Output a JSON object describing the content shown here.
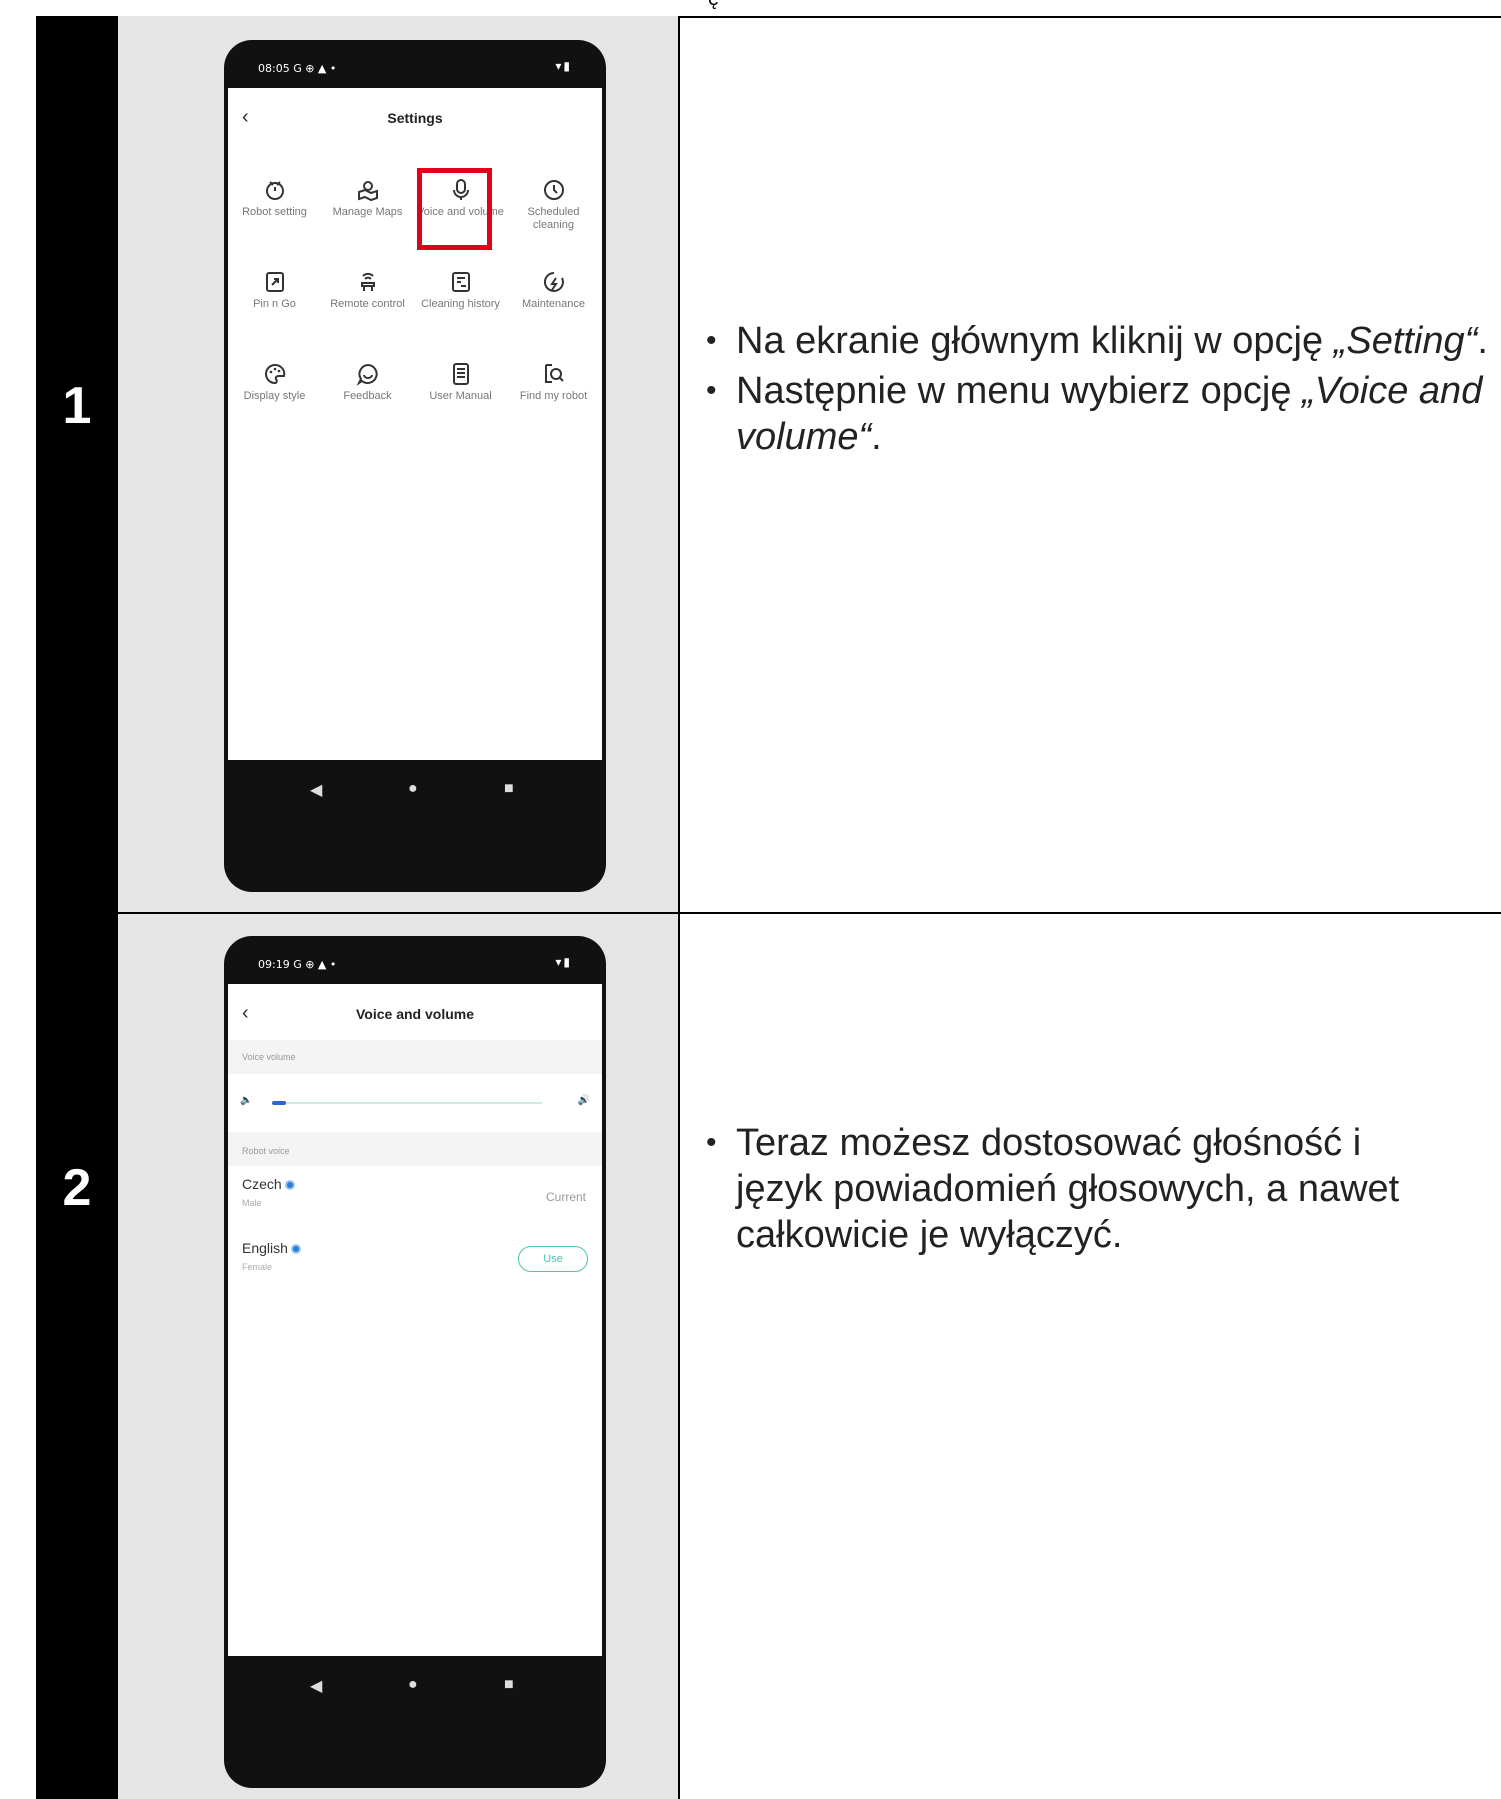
{
  "top_strip": {
    "text": "ę"
  },
  "steps": [
    {
      "number": "1",
      "phone": {
        "status_time": "08:05",
        "status_icons": "G ⊕ ▲ •",
        "status_right": "▾▮",
        "title": "Settings",
        "tiles": [
          {
            "icon": "robot-icon",
            "label": "Robot setting"
          },
          {
            "icon": "map-icon",
            "label": "Manage Maps"
          },
          {
            "icon": "microphone-icon",
            "label": "Voice and volume"
          },
          {
            "icon": "clock-icon",
            "label": "Scheduled cleaning"
          },
          {
            "icon": "pin-icon",
            "label": "Pin n Go"
          },
          {
            "icon": "remote-icon",
            "label": "Remote control"
          },
          {
            "icon": "history-icon",
            "label": "Cleaning history"
          },
          {
            "icon": "maintenance-icon",
            "label": "Maintenance"
          },
          {
            "icon": "palette-icon",
            "label": "Display style"
          },
          {
            "icon": "feedback-icon",
            "label": "Feedback"
          },
          {
            "icon": "manual-icon",
            "label": "User Manual"
          },
          {
            "icon": "find-icon",
            "label": "Find my robot"
          }
        ],
        "highlighted_tile": "Voice and volume"
      },
      "bullets": [
        {
          "text": "Na ekranie głównym kliknij w opcję ",
          "em": "„Setting“",
          "after": "."
        },
        {
          "text": "Następnie w menu wybierz opcję ",
          "em": "„Voice and volume“",
          "after": "."
        }
      ]
    },
    {
      "number": "2",
      "phone": {
        "status_time": "09:19",
        "status_icons": "G ⊕ ▲ •",
        "status_right": "▾▮",
        "title": "Voice and volume",
        "volume_section_label": "Voice volume",
        "voice_section_label": "Robot voice",
        "volume_level": 0.05,
        "voices": [
          {
            "name": "Czech",
            "sub": "Male",
            "action": "Current"
          },
          {
            "name": "English",
            "sub": "Female",
            "action": "Use"
          }
        ]
      },
      "bullets": [
        {
          "text": "Teraz możesz dostosować głośność i język powiadomień głosowych, a nawet całkowicie je wyłączyć.",
          "em": "",
          "after": ""
        }
      ]
    }
  ],
  "colors": {
    "highlight": "#e1001a",
    "accent": "#52c0b0",
    "badge": "#2b7cd3"
  }
}
